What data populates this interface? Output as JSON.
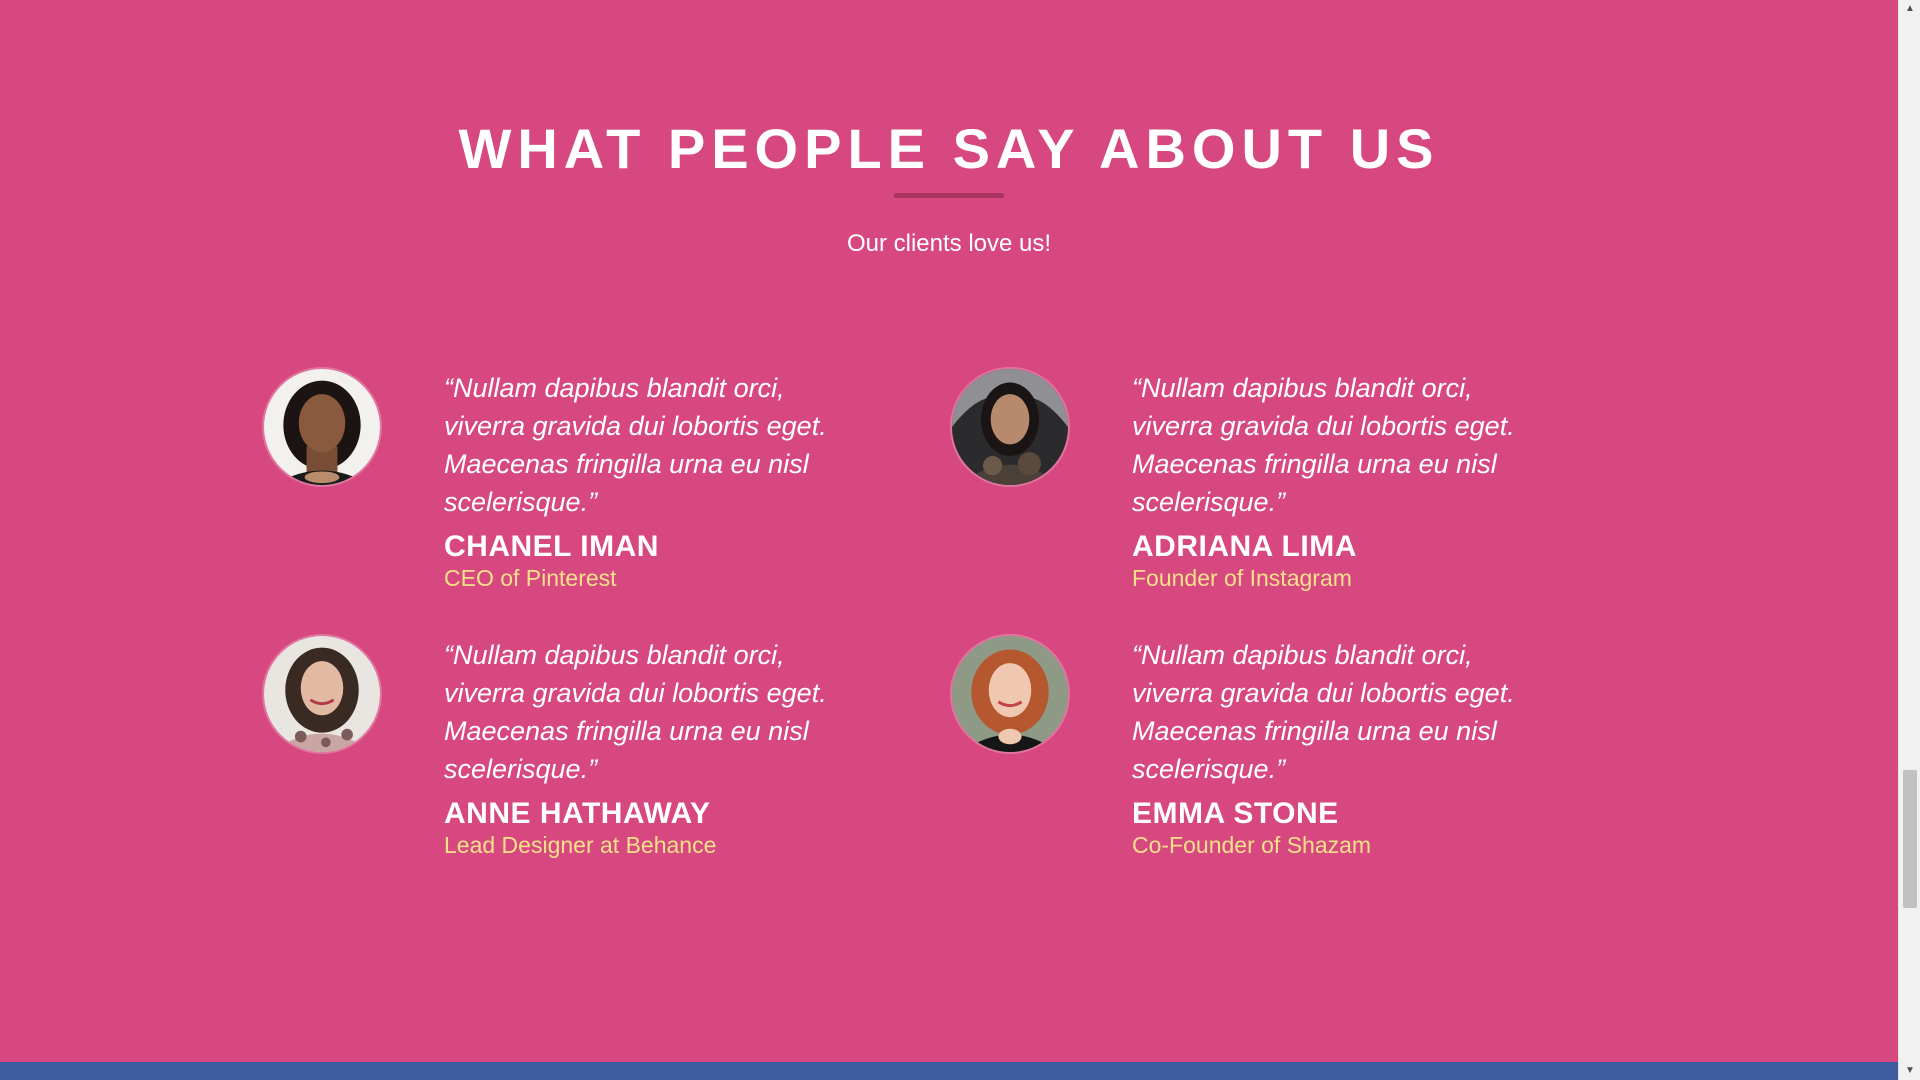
{
  "section": {
    "title": "WHAT PEOPLE SAY ABOUT US",
    "subtitle": "Our clients love us!"
  },
  "testimonials": [
    {
      "quote": "“Nullam dapibus blandit orci, viverra gravida dui lobortis eget. Maecenas fringilla urna eu nisl scelerisque.”",
      "name": "CHANEL IMAN",
      "role": "CEO of Pinterest"
    },
    {
      "quote": "“Nullam dapibus blandit orci, viverra gravida dui lobortis eget. Maecenas fringilla urna eu nisl scelerisque.”",
      "name": "ADRIANA LIMA",
      "role": "Founder of Instagram"
    },
    {
      "quote": "“Nullam dapibus blandit orci, viverra gravida dui lobortis eget. Maecenas fringilla urna eu nisl scelerisque.”",
      "name": "ANNE HATHAWAY",
      "role": "Lead Designer at Behance"
    },
    {
      "quote": "“Nullam dapibus blandit orci, viverra gravida dui lobortis eget. Maecenas fringilla urna eu nisl scelerisque.”",
      "name": "EMMA STONE",
      "role": "Co-Founder of Shazam"
    }
  ],
  "colors": {
    "background": "#d6487f",
    "accent_rule": "#a8345f",
    "role_text": "#f7e08a",
    "footer_band": "#3f5ba1"
  },
  "icons": {
    "scroll_up": "▲",
    "scroll_down": "▼"
  }
}
